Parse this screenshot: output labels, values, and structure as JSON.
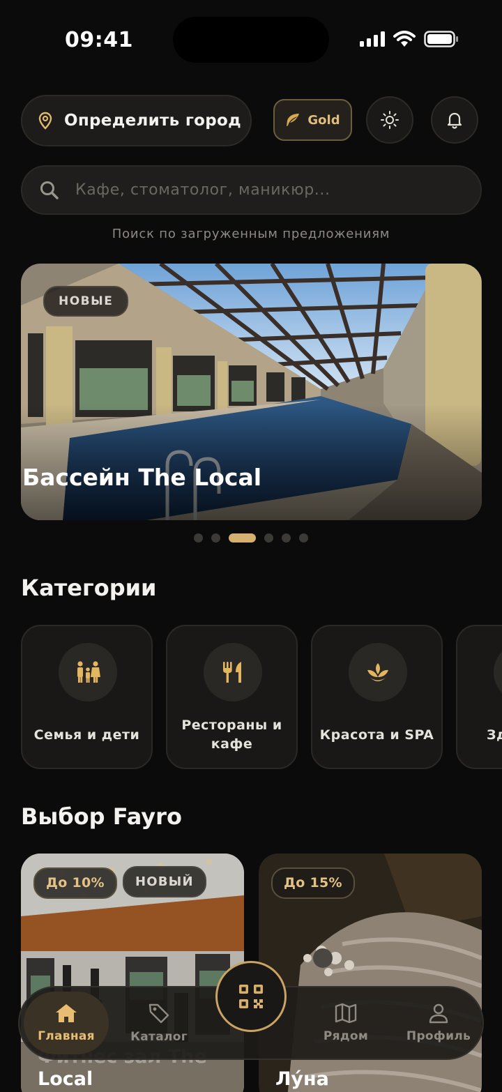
{
  "status_bar": {
    "time": "09:41",
    "icons": [
      "signal-icon",
      "wifi-icon",
      "battery-icon"
    ]
  },
  "header": {
    "city_button": "Определить город",
    "tier_badge": "Gold",
    "theme_icon": "sun-icon",
    "notifications_icon": "bell-icon"
  },
  "search": {
    "placeholder": "Кафе, стоматолог, маникюр...",
    "hint": "Поиск по загруженным предложениям"
  },
  "hero": {
    "badge": "НОВЫЕ",
    "title": "Бассейн The Local",
    "slides_count": 6,
    "active_slide": 3
  },
  "categories": {
    "title": "Категории",
    "items": [
      {
        "label": "Семья и дети",
        "icon": "family-icon"
      },
      {
        "label": "Рестораны и кафе",
        "icon": "fork-knife-icon"
      },
      {
        "label": "Красота и SPA",
        "icon": "lotus-icon"
      },
      {
        "label": "Зд",
        "icon": "health-icon"
      }
    ]
  },
  "choice": {
    "title": "Выбор Fayro",
    "cards": [
      {
        "discount": "До 10%",
        "badge": "НОВЫЙ",
        "title_line1": "Фитнес зал The",
        "title_line2": "Local"
      },
      {
        "discount": "До 15%",
        "title": "Лу́на"
      }
    ]
  },
  "nav": {
    "items": [
      {
        "label": "Главная",
        "icon": "home-icon",
        "active": true
      },
      {
        "label": "Каталог",
        "icon": "tag-icon",
        "active": false
      },
      {
        "label": "Рядом",
        "icon": "map-icon",
        "active": false
      },
      {
        "label": "Профиль",
        "icon": "user-icon",
        "active": false
      }
    ],
    "center_icon": "qr-code-icon"
  },
  "colors": {
    "background": "#0b0b0b",
    "accent_gold": "#d6b071",
    "surface": "#1d1c1a"
  }
}
